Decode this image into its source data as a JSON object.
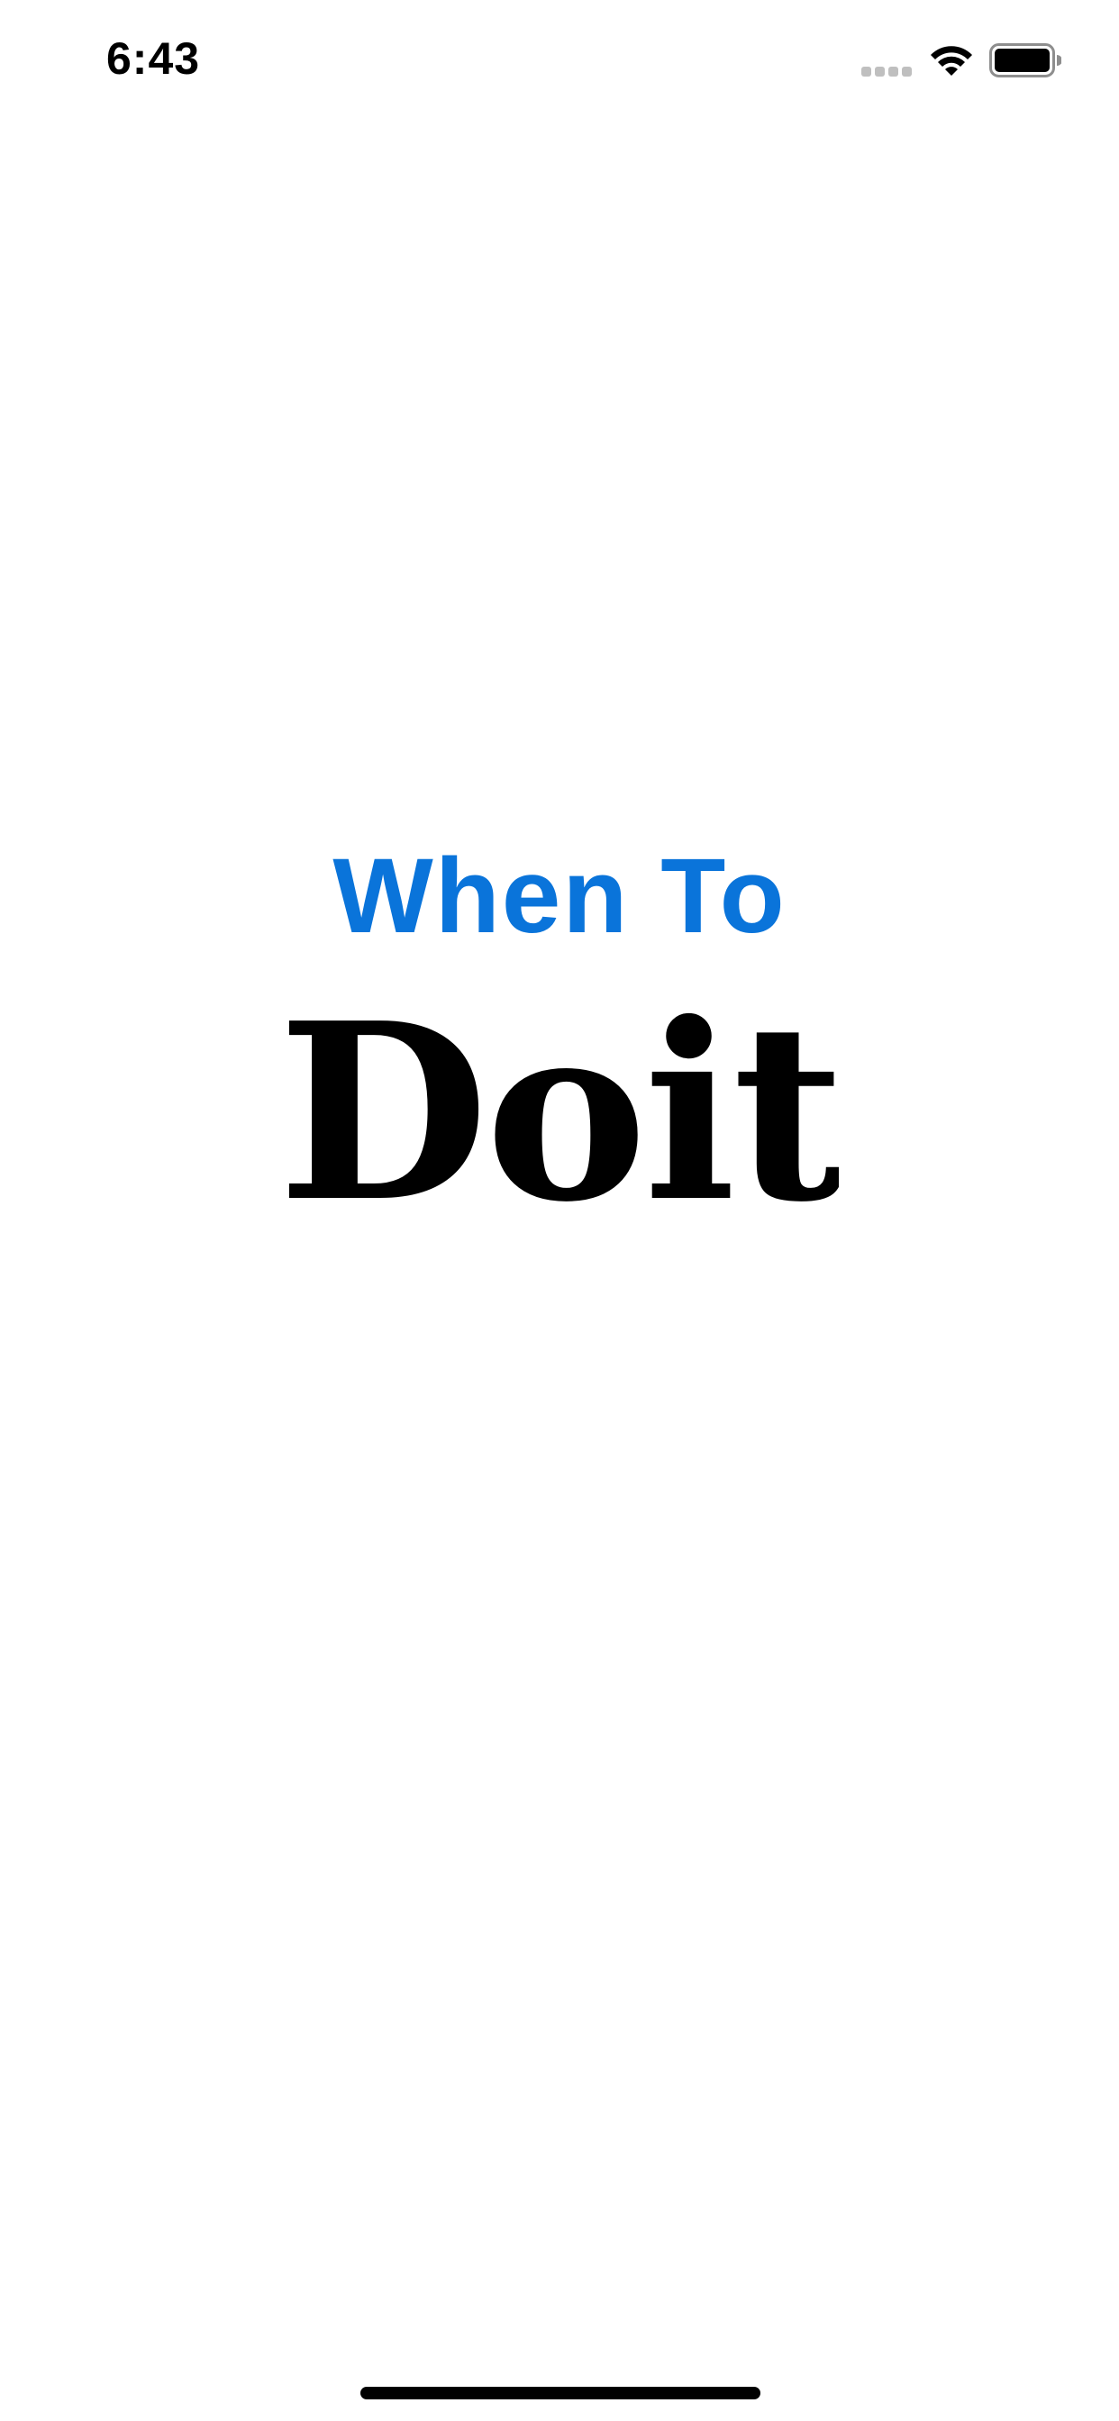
{
  "status_bar": {
    "time": "6:43",
    "wifi_icon": "wifi-icon",
    "battery_icon": "battery-icon",
    "signal_icon": "cellular-signal-icon"
  },
  "logo": {
    "line1": "When To",
    "line2": "Doit",
    "line1_color": "#0A74DA",
    "line2_color": "#000000"
  }
}
